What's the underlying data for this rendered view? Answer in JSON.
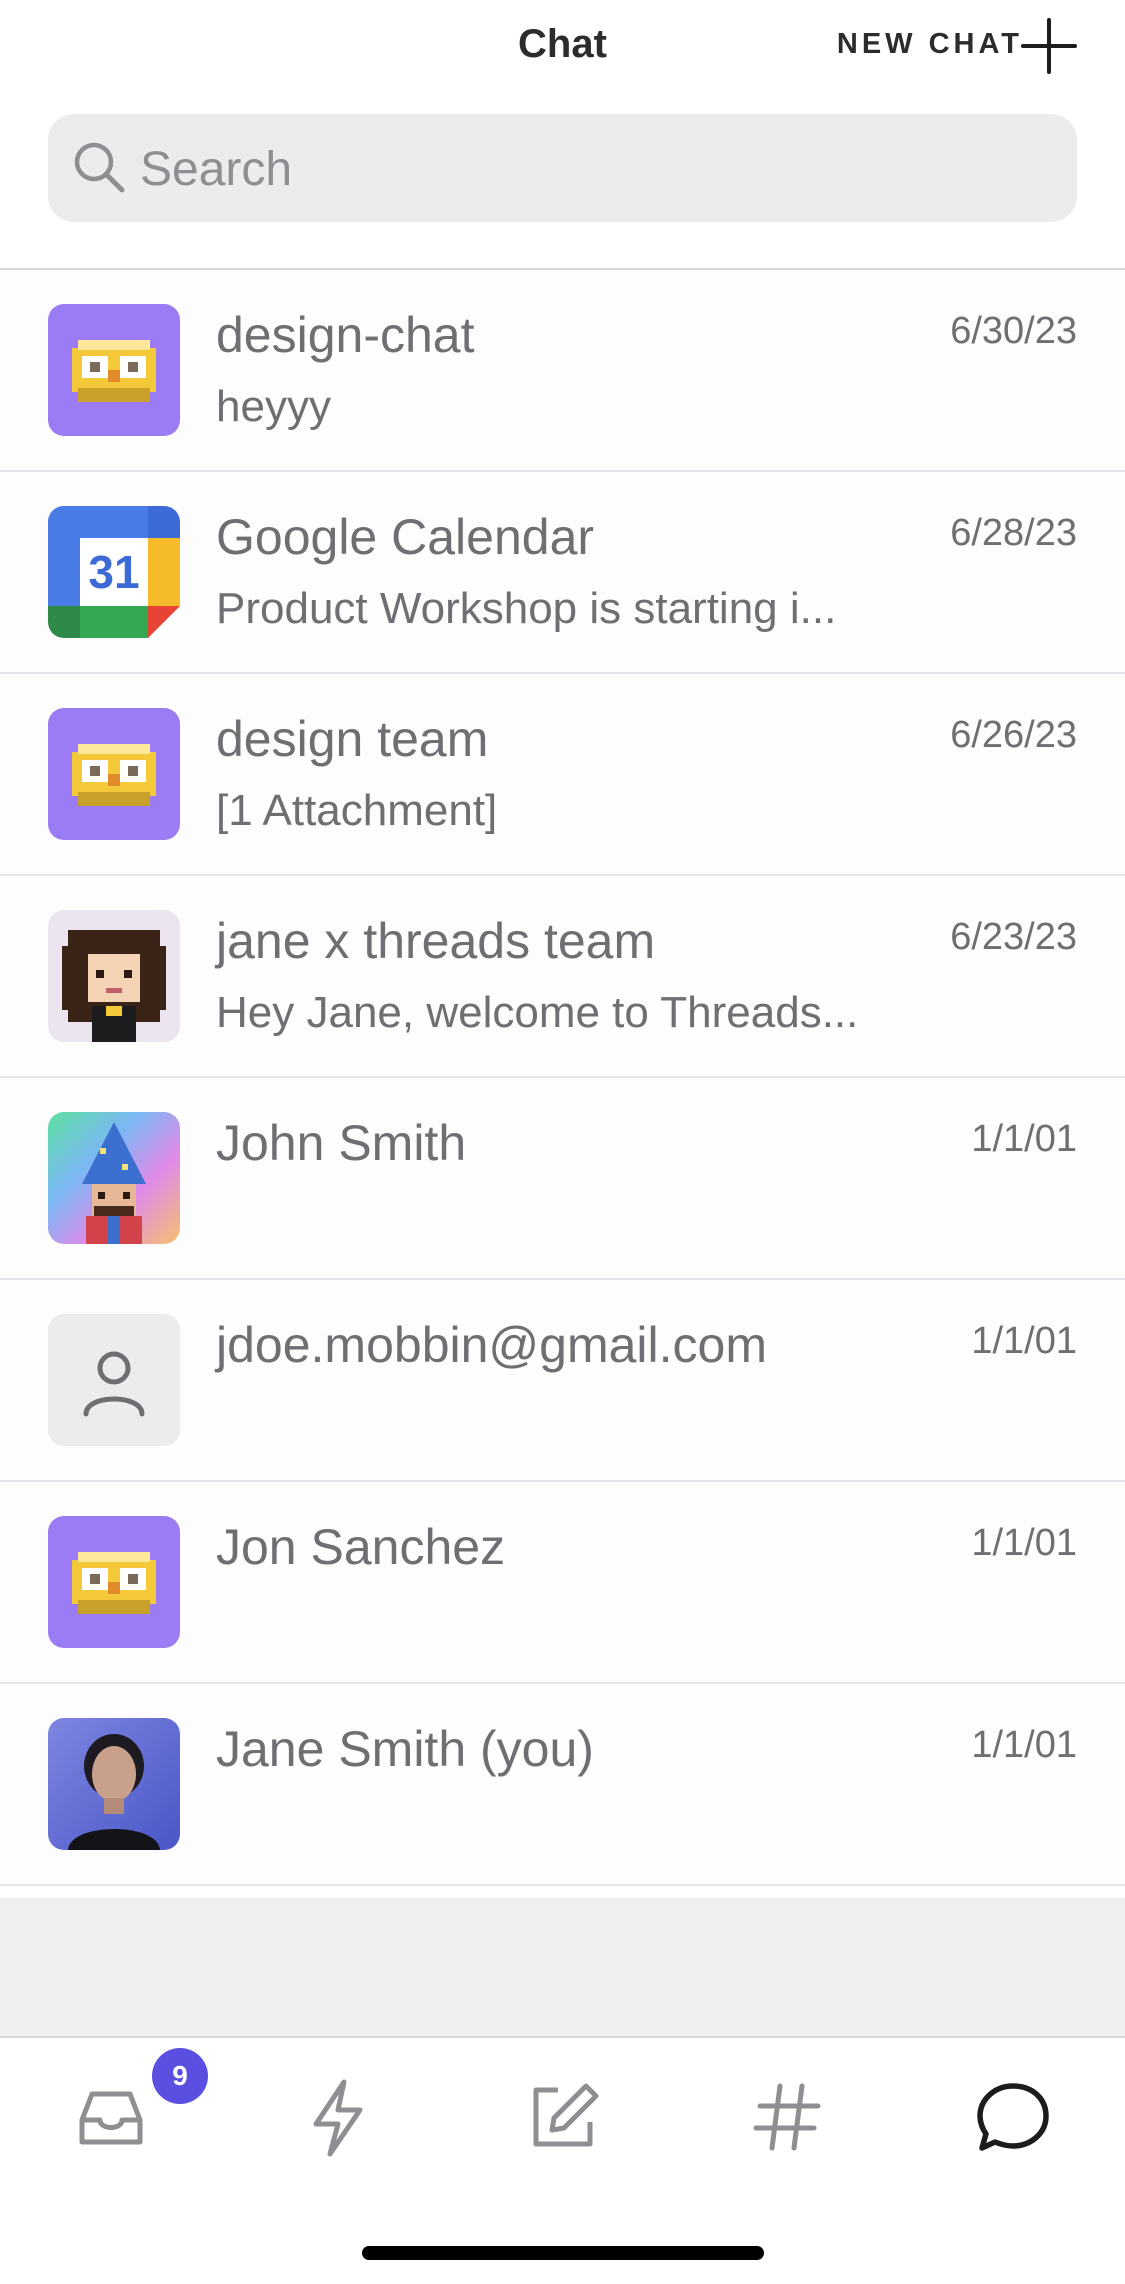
{
  "header": {
    "title": "Chat",
    "new_chat_label": "NEW CHAT"
  },
  "search": {
    "placeholder": "Search"
  },
  "conversations": [
    {
      "name": "design-chat",
      "preview": "heyyy",
      "date": "6/30/23",
      "avatar": "owl-pixel-avatar"
    },
    {
      "name": "Google Calendar",
      "preview": "Product Workshop is starting i...",
      "date": "6/28/23",
      "avatar": "google-calendar-icon",
      "calendar_day": "31"
    },
    {
      "name": "design team",
      "preview": "[1 Attachment]",
      "date": "6/26/23",
      "avatar": "owl-pixel-avatar"
    },
    {
      "name": "jane x threads team",
      "preview": "Hey Jane, welcome to Threads...",
      "date": "6/23/23",
      "avatar": "pixel-girl-avatar"
    },
    {
      "name": "John Smith",
      "preview": "",
      "date": "1/1/01",
      "avatar": "pixel-wizard-avatar"
    },
    {
      "name": "jdoe.mobbin@gmail.com",
      "preview": "",
      "date": "1/1/01",
      "avatar": "person-placeholder-icon"
    },
    {
      "name": "Jon Sanchez",
      "preview": "",
      "date": "1/1/01",
      "avatar": "owl-pixel-avatar"
    },
    {
      "name": "Jane Smith (you)",
      "preview": "",
      "date": "1/1/01",
      "avatar": "photo-avatar"
    }
  ],
  "tabbar": {
    "items": [
      "inbox-icon",
      "lightning-icon",
      "compose-icon",
      "hashtag-icon",
      "chat-bubble-icon"
    ],
    "inbox_badge": "9",
    "active": "chat-bubble-icon"
  },
  "colors": {
    "accent": "#5a4fe0",
    "owl_bg": "#9b7cf5",
    "text_secondary": "#6e6e73"
  }
}
